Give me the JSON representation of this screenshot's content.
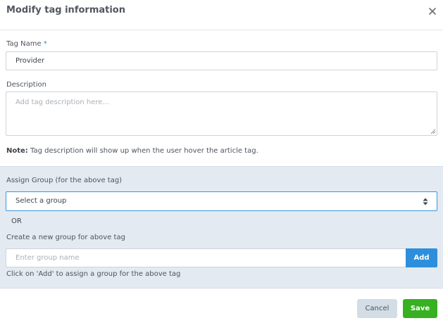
{
  "dialog": {
    "title": "Modify tag information",
    "close_icon": "close-icon"
  },
  "tag_name": {
    "label": "Tag Name",
    "required_marker": "*",
    "value": "Provider"
  },
  "description": {
    "label": "Description",
    "placeholder": "Add tag description here...",
    "value": ""
  },
  "note": {
    "prefix": "Note:",
    "text": " Tag description will show up when the user hover the article tag."
  },
  "assign_group": {
    "label": "Assign Group (for the above tag)",
    "select_value": "Select a group",
    "select_icon": "updown-arrows-icon",
    "or_text": "OR",
    "create_label": "Create a new group for above tag",
    "group_placeholder": "Enter group name",
    "add_label": "Add",
    "hint": "Click on 'Add' to assign a group for the above tag"
  },
  "footer": {
    "cancel_label": "Cancel",
    "save_label": "Save"
  },
  "colors": {
    "primary": "#2d8fdc",
    "success": "#37b021",
    "panel_bg": "#e3eaf2",
    "cancel_bg": "#d3dde6"
  }
}
